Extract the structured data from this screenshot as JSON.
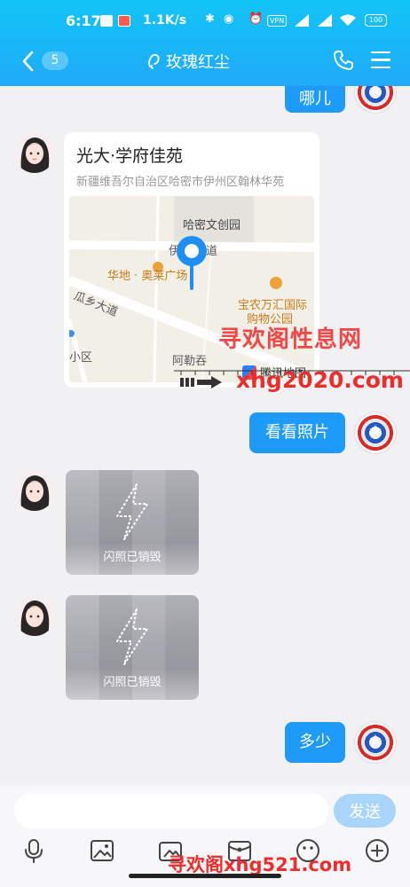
{
  "status_bar": {
    "time": "6:17",
    "speed": "1.1K/s",
    "vpn": "VPN",
    "battery": "100"
  },
  "header": {
    "unread_count": "5",
    "title": "玫瑰红尘"
  },
  "messages": {
    "me_1": "哪儿",
    "location": {
      "name": "光大·学府佳苑",
      "address": "新疆维吾尔自治区哈密市伊州区翰林华苑",
      "map_labels": {
        "park": "哈密文创园",
        "street_top": "伊",
        "street_top2": "道",
        "mall": "华地 · 奥莱广场",
        "road": "瓜乡大道",
        "poi2": "宝农万汇国际",
        "poi2_line2": "购物公园",
        "district": "小区",
        "area": "阿勒吞",
        "provider": "腾讯地图"
      }
    },
    "me_2": "看看照片",
    "flash_1": "闪照已销毁",
    "flash_2": "闪照已销毁",
    "me_3": "多少"
  },
  "watermarks": {
    "top": "寻欢阁性息网",
    "middle": "xhg2020.com",
    "bottom": "寻欢阁xhg521.com"
  },
  "input": {
    "value": "",
    "send_label": "发送"
  },
  "colors": {
    "header": "#1ab5f8",
    "my_bubble": "#1e9af8",
    "send_disabled": "#a9d5fb",
    "watermark": "#ee2c2c"
  }
}
